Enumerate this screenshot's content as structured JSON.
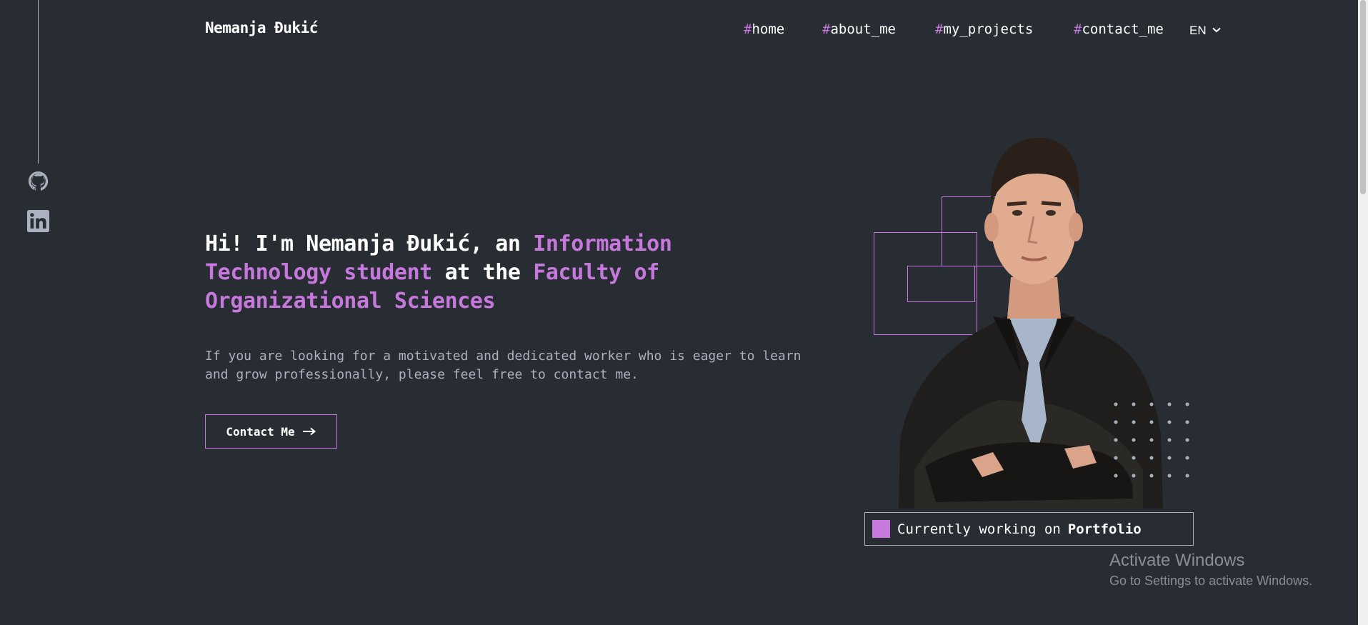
{
  "header": {
    "brand": "Nemanja Đukić",
    "nav": [
      {
        "hash": "#",
        "label": "home"
      },
      {
        "hash": "#",
        "label": "about_me"
      },
      {
        "hash": "#",
        "label": "my_projects"
      },
      {
        "hash": "#",
        "label": "contact_me"
      }
    ],
    "language": "EN"
  },
  "social": {
    "icons": [
      "github-icon",
      "linkedin-icon"
    ]
  },
  "hero": {
    "title_part1": "Hi! I'm Nemanja Đukić, an ",
    "title_accent1": "Information Technology student",
    "title_part2": " at the ",
    "title_accent2": "Faculty of Organizational Sciences",
    "description": "If you are looking for a motivated and dedicated worker who is eager to learn and grow professionally, please feel free to contact me.",
    "button_label": "Contact Me"
  },
  "status": {
    "prefix": "Currently working on",
    "project": "Portfolio"
  },
  "watermark": {
    "title": "Activate Windows",
    "subtitle": "Go to Settings to activate Windows."
  },
  "colors": {
    "background": "#282c33",
    "accent": "#c778dd",
    "text": "#ffffff",
    "muted": "#abb2bf"
  }
}
